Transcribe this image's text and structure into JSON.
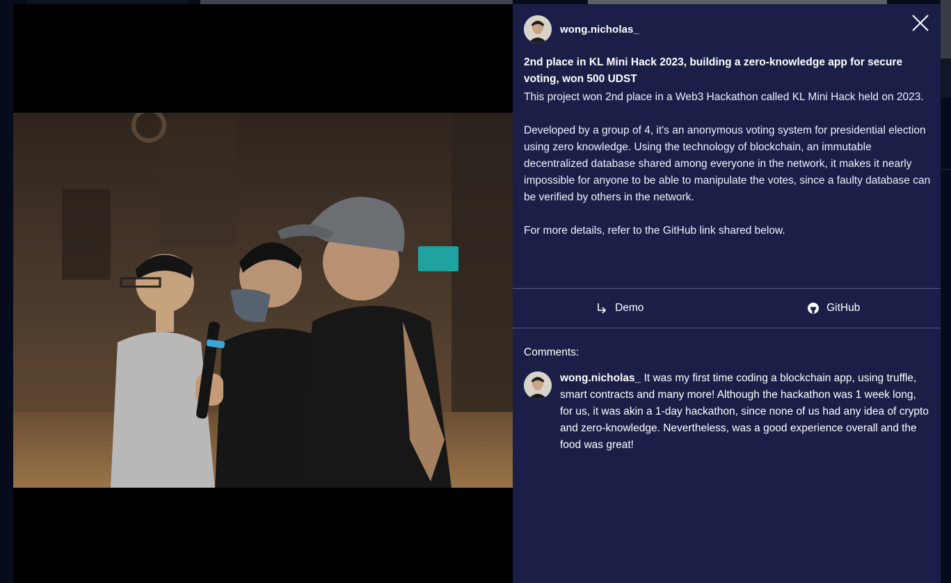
{
  "post": {
    "username": "wong.nicholas_",
    "title": "2nd place in KL Mini Hack 2023, building a zero-knowledge app for secure voting, won 500 UDST",
    "description": [
      "This project won 2nd place in a Web3 Hackathon called KL Mini Hack held on 2023.",
      "Developed by a group of 4, it's an anonymous voting system for presidential election using zero knowledge. Using the technology of blockchain, an immutable decentralized database shared among everyone in the network,  it makes it nearly impossible for anyone to be able to manipulate the votes, since a faulty database can be verified by others in the network.",
      "For more details, refer to the GitHub link shared below."
    ]
  },
  "actions": {
    "demo_label": "Demo",
    "demo_icon": "arrow-turn-down-right-icon",
    "github_label": "GitHub",
    "github_icon": "github-icon"
  },
  "comments": {
    "label": "Comments:",
    "items": [
      {
        "username": "wong.nicholas_",
        "text": " It was my first time coding a blockchain app, using truffle, smart contracts and many more! Although the hackathon was 1 week long, for us, it was akin a 1-day hackathon, since none of us had any idea of crypto and zero-knowledge. Nevertheless, was a good experience overall and the food was great!"
      }
    ]
  },
  "colors": {
    "panel_bg": "#1b1f47",
    "media_bg": "#000000",
    "divider": "#5a5f8a"
  }
}
